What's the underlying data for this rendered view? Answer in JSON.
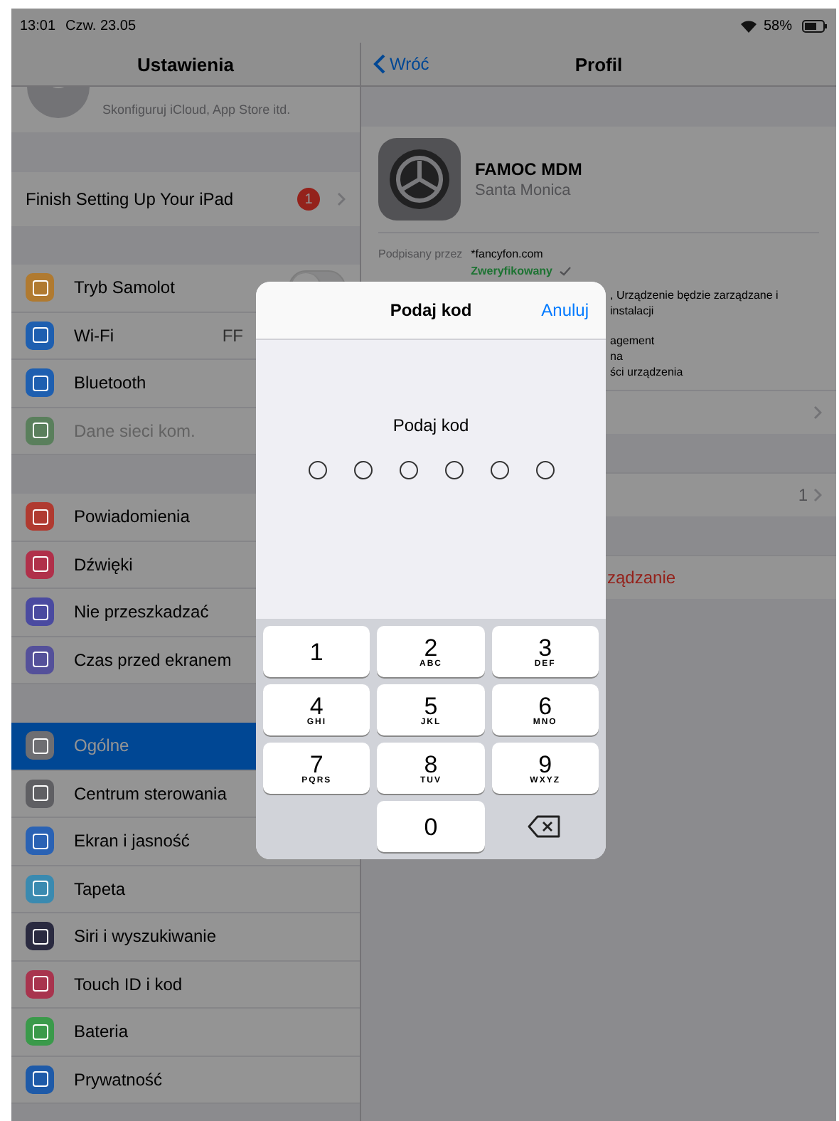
{
  "status_bar": {
    "time": "13:01",
    "date": "Czw. 23.05",
    "battery": "58%"
  },
  "sidebar": {
    "title": "Ustawienia",
    "profile_subtitle": "Skonfiguruj iCloud, App Store itd.",
    "finish_row": {
      "label": "Finish Setting Up Your iPad",
      "badge": "1"
    },
    "groups": [
      [
        {
          "kind": "toggle",
          "label": "Tryb Samolot",
          "color": "#b07a30",
          "on": false,
          "selected": false,
          "disabled": false
        },
        {
          "kind": "link",
          "label": "Wi-Fi",
          "value": "FF",
          "color": "#1e5fb0",
          "selected": false,
          "disabled": false
        },
        {
          "kind": "link",
          "label": "Bluetooth",
          "color": "#1e5fb0",
          "selected": false,
          "disabled": false
        },
        {
          "kind": "link",
          "label": "Dane sieci kom.",
          "color": "#5a7f5c",
          "selected": false,
          "disabled": true
        }
      ],
      [
        {
          "kind": "link",
          "label": "Powiadomienia",
          "color": "#b03a30",
          "selected": false,
          "disabled": false
        },
        {
          "kind": "link",
          "label": "Dźwięki",
          "color": "#b0304a",
          "selected": false,
          "disabled": false
        },
        {
          "kind": "link",
          "label": "Nie przeszkadzać",
          "color": "#4a4aa0",
          "selected": false,
          "disabled": false
        },
        {
          "kind": "link",
          "label": "Czas przed ekranem",
          "color": "#54509a",
          "selected": false,
          "disabled": false
        }
      ],
      [
        {
          "kind": "link",
          "label": "Ogólne",
          "color": "#6e6e72",
          "selected": true,
          "disabled": false
        },
        {
          "kind": "link",
          "label": "Centrum sterowania",
          "color": "#5f5f63",
          "selected": false,
          "disabled": false
        },
        {
          "kind": "link",
          "label": "Ekran i jasność",
          "color": "#2a62b4",
          "selected": false,
          "disabled": false
        },
        {
          "kind": "link",
          "label": "Tapeta",
          "color": "#3a8ab0",
          "selected": false,
          "disabled": false
        },
        {
          "kind": "link",
          "label": "Siri i wyszukiwanie",
          "color": "#2a2a40",
          "selected": false,
          "disabled": false
        },
        {
          "kind": "link",
          "label": "Touch ID i kod",
          "color": "#a8344e",
          "selected": false,
          "disabled": false
        },
        {
          "kind": "link",
          "label": "Bateria",
          "color": "#3a9a4a",
          "selected": false,
          "disabled": false
        },
        {
          "kind": "link",
          "label": "Prywatność",
          "color": "#1e5aa8",
          "selected": false,
          "disabled": false
        }
      ]
    ]
  },
  "detail": {
    "back": "Wróć",
    "title": "Profil",
    "profile_name": "FAMOC MDM",
    "profile_org": "Santa Monica",
    "signed_label": "Podpisany przez",
    "signed_value": "*fancyfon.com",
    "verified": "Zweryfikowany",
    "description_fragments": [
      ", Urządzenie będzie zarządzane i",
      "instalacji"
    ],
    "contains_fragments": [
      "agement",
      "na",
      "ści urządzenia"
    ],
    "row_value": "1",
    "action": "ządzanie"
  },
  "dialog": {
    "title": "Podaj kod",
    "cancel": "Anuluj",
    "prompt": "Podaj kod",
    "code_slots": [
      {
        "filled": false
      },
      {
        "filled": false
      },
      {
        "filled": false
      },
      {
        "filled": false
      },
      {
        "filled": false
      },
      {
        "filled": false
      }
    ],
    "keys": [
      {
        "kind": "digit",
        "digit": "1"
      },
      {
        "kind": "digit",
        "digit": "2",
        "letters": "ABC"
      },
      {
        "kind": "digit",
        "digit": "3",
        "letters": "DEF"
      },
      {
        "kind": "digit",
        "digit": "4",
        "letters": "GHI"
      },
      {
        "kind": "digit",
        "digit": "5",
        "letters": "JKL"
      },
      {
        "kind": "digit",
        "digit": "6",
        "letters": "MNO"
      },
      {
        "kind": "digit",
        "digit": "7",
        "letters": "PQRS"
      },
      {
        "kind": "digit",
        "digit": "8",
        "letters": "TUV"
      },
      {
        "kind": "digit",
        "digit": "9",
        "letters": "WXYZ"
      },
      {
        "kind": "blank"
      },
      {
        "kind": "digit",
        "digit": "0"
      },
      {
        "kind": "delete"
      }
    ]
  }
}
